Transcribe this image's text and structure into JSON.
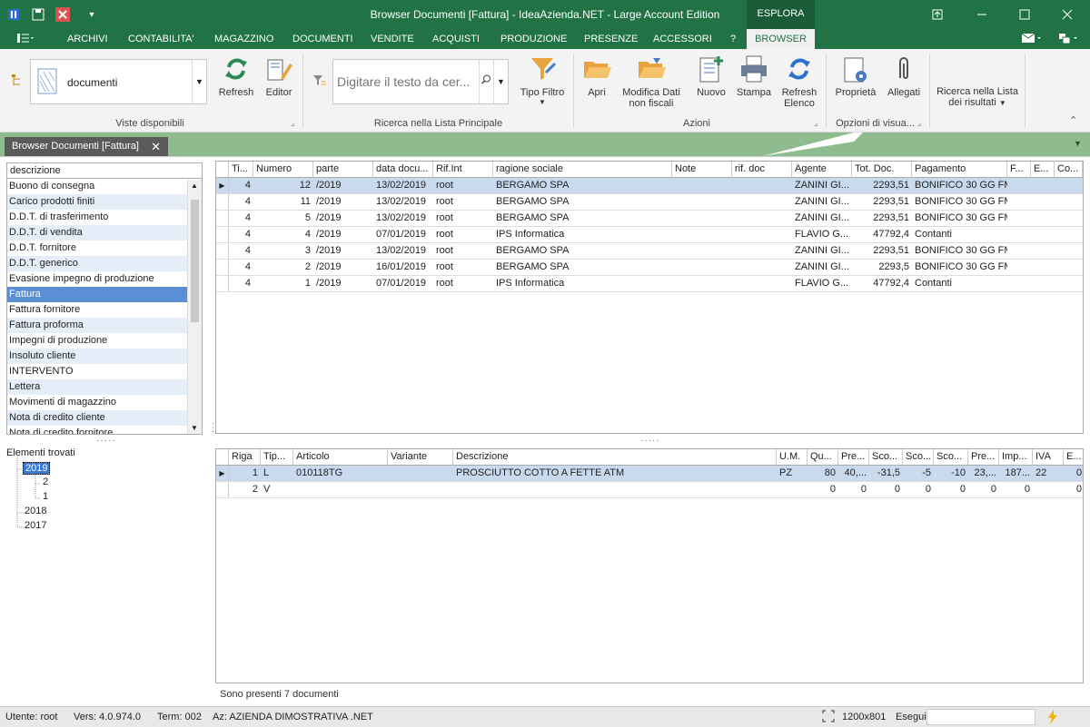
{
  "titlebar": {
    "title": "Browser Documenti [Fattura] - IdeaAzienda.NET - Large Account Edition",
    "esplora_tab": "ESPLORA",
    "accent": "#217346"
  },
  "menu": {
    "items": [
      "ARCHIVI",
      "CONTABILITA'",
      "MAGAZZINO",
      "DOCUMENTI",
      "VENDITE",
      "ACQUISTI",
      "PRODUZIONE",
      "PRESENZE",
      "ACCESSORI",
      "?"
    ],
    "active": "BROWSER"
  },
  "ribbon": {
    "view_select_value": "documenti",
    "refresh": "Refresh",
    "editor": "Editor",
    "group_viste": "Viste disponibili",
    "search_placeholder": "Digitare il testo da cer...",
    "tipo_filtro": "Tipo Filtro",
    "group_ricerca": "Ricerca nella Lista Principale",
    "apri": "Apri",
    "modifica_line1": "Modifica Dati",
    "modifica_line2": "non fiscali",
    "nuovo": "Nuovo",
    "stampa": "Stampa",
    "refresh_elenco_line1": "Refresh",
    "refresh_elenco_line2": "Elenco",
    "group_azioni": "Azioni",
    "proprieta": "Proprietà",
    "allegati": "Allegati",
    "group_opzioni": "Opzioni di visua...",
    "ricerca_risultati_line1": "Ricerca nella Lista",
    "ricerca_risultati_line2": "dei risultati"
  },
  "doc_tab": {
    "label": "Browser Documenti [Fattura]"
  },
  "left_list": {
    "header": "descrizione",
    "items": [
      "Buono di consegna",
      "Carico prodotti finiti",
      "D.D.T. di trasferimento",
      "D.D.T. di vendita",
      "D.D.T. fornitore",
      "D.D.T. generico",
      "Evasione impegno di produzione",
      "Fattura",
      "Fattura fornitore",
      "Fattura proforma",
      "Impegni di produzione",
      "Insoluto cliente",
      "INTERVENTO",
      "Lettera",
      "Movimenti di magazzino",
      "Nota di credito cliente",
      "Nota di credito fornitore"
    ],
    "selected_index": 7
  },
  "tree": {
    "root": "Elementi trovati",
    "y2019": "2019",
    "c2": "2",
    "c1": "1",
    "y2018": "2018",
    "y2017": "2017"
  },
  "docs_grid": {
    "columns": [
      "Ti...",
      "Numero",
      "parte",
      "data docu...",
      "Rif.Int",
      "ragione sociale",
      "Note",
      "rif. doc",
      "Agente",
      "Tot. Doc.",
      "Pagamento",
      "F...",
      "E...",
      "Co..."
    ],
    "rows": [
      [
        "4",
        "12",
        "/2019",
        "13/02/2019",
        "root",
        "BERGAMO SPA",
        "",
        "",
        "ZANINI GI...",
        "2293,51",
        "BONIFICO 30 GG FM",
        "",
        "",
        ""
      ],
      [
        "4",
        "11",
        "/2019",
        "13/02/2019",
        "root",
        "BERGAMO SPA",
        "",
        "",
        "ZANINI GI...",
        "2293,51",
        "BONIFICO 30 GG FM",
        "",
        "",
        ""
      ],
      [
        "4",
        "5",
        "/2019",
        "13/02/2019",
        "root",
        "BERGAMO SPA",
        "",
        "",
        "ZANINI GI...",
        "2293,51",
        "BONIFICO 30 GG FM",
        "",
        "",
        ""
      ],
      [
        "4",
        "4",
        "/2019",
        "07/01/2019",
        "root",
        "IPS Informatica",
        "",
        "",
        "FLAVIO G...",
        "47792,4",
        "Contanti",
        "",
        "",
        ""
      ],
      [
        "4",
        "3",
        "/2019",
        "13/02/2019",
        "root",
        "BERGAMO SPA",
        "",
        "",
        "ZANINI GI...",
        "2293,51",
        "BONIFICO 30 GG FM",
        "",
        "",
        ""
      ],
      [
        "4",
        "2",
        "/2019",
        "16/01/2019",
        "root",
        "BERGAMO SPA",
        "",
        "",
        "ZANINI GI...",
        "2293,5",
        "BONIFICO 30 GG FM",
        "",
        "",
        ""
      ],
      [
        "4",
        "1",
        "/2019",
        "07/01/2019",
        "root",
        "IPS Informatica",
        "",
        "",
        "FLAVIO G...",
        "47792,4",
        "Contanti",
        "",
        "",
        ""
      ]
    ]
  },
  "lines_grid": {
    "columns": [
      "Riga",
      "Tip...",
      "Articolo",
      "Variante",
      "Descrizione",
      "U.M.",
      "Qu...",
      "Pre...",
      "Sco...",
      "Sco...",
      "Sco...",
      "Pre...",
      "Imp...",
      "IVA",
      "E..."
    ],
    "rows": [
      [
        "1",
        "L",
        "010118TG",
        "",
        "PROSCIUTTO COTTO A FETTE ATM",
        "PZ",
        "80",
        "40,...",
        "-31,5",
        "-5",
        "-10",
        "23,...",
        "187...",
        "22",
        "0"
      ],
      [
        "2",
        "V",
        "",
        "",
        "",
        "",
        "0",
        "0",
        "0",
        "0",
        "0",
        "0",
        "0",
        "",
        "0"
      ]
    ]
  },
  "status_text": "Sono presenti 7 documenti",
  "statusbar": {
    "utente": "Utente: root",
    "vers": "Vers: 4.0.974.0",
    "term": "Term: 002",
    "az": "Az: AZIENDA DIMOSTRATIVA .NET",
    "resolution": "1200x801",
    "esegui": "Esegui"
  }
}
